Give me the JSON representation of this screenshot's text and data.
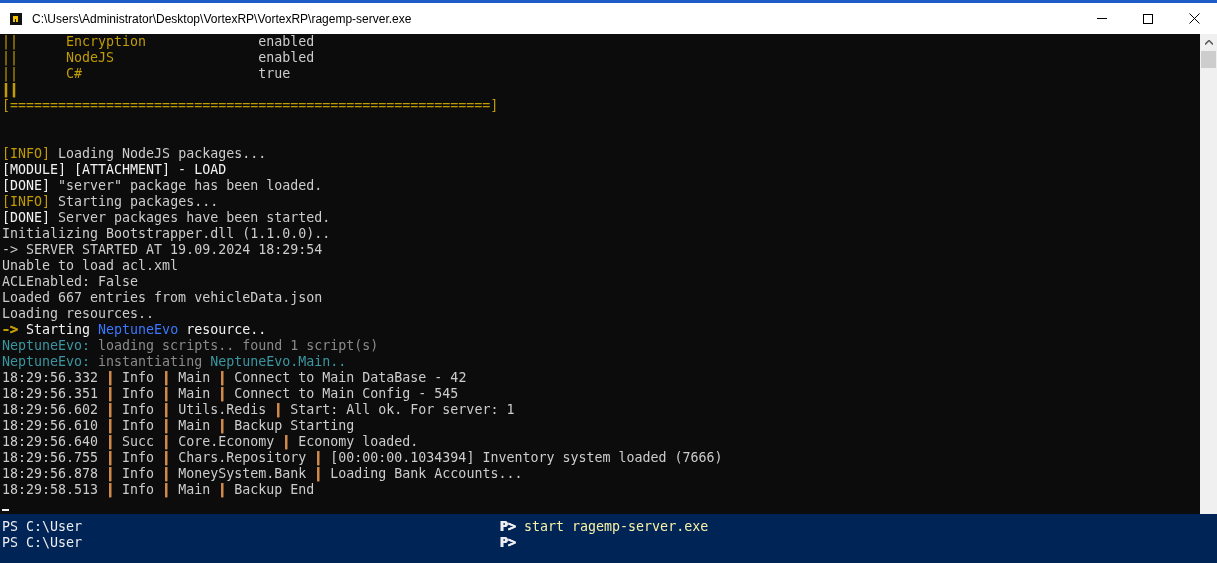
{
  "window": {
    "title": "C:\\Users\\Administrator\\Desktop\\VortexRP\\VortexRP\\ragemp-server.exe"
  },
  "console": {
    "lines": [
      {
        "kind": "text",
        "segments": [
          {
            "text": "||      Encryption              ",
            "color": "#c19c00"
          },
          {
            "text": "enabled",
            "color": "#cccccc"
          }
        ]
      },
      {
        "kind": "text",
        "segments": [
          {
            "text": "||      NodeJS                  ",
            "color": "#c19c00"
          },
          {
            "text": "enabled",
            "color": "#cccccc"
          }
        ]
      },
      {
        "kind": "text",
        "segments": [
          {
            "text": "||      C#                      ",
            "color": "#c19c00"
          },
          {
            "text": "true",
            "color": "#cccccc"
          }
        ]
      },
      {
        "kind": "text",
        "segments": [
          {
            "text": "||",
            "color": "#c19c00"
          }
        ]
      },
      {
        "kind": "text",
        "segments": [
          {
            "text": "[============================================================]",
            "color": "#c19c00"
          }
        ]
      },
      {
        "kind": "blank"
      },
      {
        "kind": "blank"
      },
      {
        "kind": "text",
        "segments": [
          {
            "text": "[INFO]",
            "color": "#c19c00"
          },
          {
            "text": " Loading NodeJS packages...",
            "color": "#cccccc"
          }
        ]
      },
      {
        "kind": "text",
        "segments": [
          {
            "text": "[MODULE] [ATTACHMENT] - LOAD",
            "color": "#f2f2f2"
          }
        ]
      },
      {
        "kind": "text",
        "segments": [
          {
            "text": "[DONE]",
            "color": "#f2f2f2"
          },
          {
            "text": " \"server\" package has been loaded.",
            "color": "#cccccc"
          }
        ]
      },
      {
        "kind": "text",
        "segments": [
          {
            "text": "[INFO]",
            "color": "#c19c00"
          },
          {
            "text": " Starting packages...",
            "color": "#cccccc"
          }
        ]
      },
      {
        "kind": "text",
        "segments": [
          {
            "text": "[DONE]",
            "color": "#f2f2f2"
          },
          {
            "text": " Server packages have been started.",
            "color": "#cccccc"
          }
        ]
      },
      {
        "kind": "text",
        "segments": [
          {
            "text": "Initializing Bootstrapper.dll (1.1.0.0)..",
            "color": "#cccccc"
          }
        ]
      },
      {
        "kind": "text",
        "segments": [
          {
            "text": "-> SERVER STARTED AT 19.09.2024 18:29:54",
            "color": "#cccccc"
          }
        ]
      },
      {
        "kind": "text",
        "segments": [
          {
            "text": "Unable to load acl.xml",
            "color": "#cccccc"
          }
        ]
      },
      {
        "kind": "text",
        "segments": [
          {
            "text": "ACLEnabled: False",
            "color": "#cccccc"
          }
        ]
      },
      {
        "kind": "text",
        "segments": [
          {
            "text": "Loaded 667 entries from vehicleData.json",
            "color": "#cccccc"
          }
        ]
      },
      {
        "kind": "text",
        "segments": [
          {
            "text": "Loading resources..",
            "color": "#cccccc"
          }
        ]
      },
      {
        "kind": "text",
        "segments": [
          {
            "text": "->",
            "color": "#c19c00"
          },
          {
            "text": " Starting ",
            "color": "#f2f2f2"
          },
          {
            "text": "NeptuneEvo",
            "color": "#3b78ff"
          },
          {
            "text": " resource..",
            "color": "#f2f2f2"
          }
        ]
      },
      {
        "kind": "text",
        "segments": [
          {
            "text": "NeptuneEvo:",
            "color": "#3a96a0"
          },
          {
            "text": " loading scripts.. found 1 script(s)",
            "color": "#8a8a8a"
          }
        ]
      },
      {
        "kind": "text",
        "segments": [
          {
            "text": "NeptuneEvo:",
            "color": "#3a96a0"
          },
          {
            "text": " instantiating ",
            "color": "#8a8a8a"
          },
          {
            "text": "NeptuneEvo.Main..",
            "color": "#3a96a0"
          }
        ]
      },
      {
        "kind": "text",
        "segments": [
          {
            "text": "18:29:56.332 ",
            "color": "#cccccc"
          },
          {
            "text": "|",
            "color": "#d08a4a"
          },
          {
            "text": " Info ",
            "color": "#cccccc"
          },
          {
            "text": "|",
            "color": "#d08a4a"
          },
          {
            "text": " Main ",
            "color": "#cccccc"
          },
          {
            "text": "|",
            "color": "#d08a4a"
          },
          {
            "text": " Connect to Main DataBase - 42",
            "color": "#cccccc"
          }
        ]
      },
      {
        "kind": "text",
        "segments": [
          {
            "text": "18:29:56.351 ",
            "color": "#cccccc"
          },
          {
            "text": "|",
            "color": "#d08a4a"
          },
          {
            "text": " Info ",
            "color": "#cccccc"
          },
          {
            "text": "|",
            "color": "#d08a4a"
          },
          {
            "text": " Main ",
            "color": "#cccccc"
          },
          {
            "text": "|",
            "color": "#d08a4a"
          },
          {
            "text": " Connect to Main Config - 545",
            "color": "#cccccc"
          }
        ]
      },
      {
        "kind": "text",
        "segments": [
          {
            "text": "18:29:56.602 ",
            "color": "#cccccc"
          },
          {
            "text": "|",
            "color": "#d08a4a"
          },
          {
            "text": " Info ",
            "color": "#cccccc"
          },
          {
            "text": "|",
            "color": "#d08a4a"
          },
          {
            "text": " Utils.Redis ",
            "color": "#cccccc"
          },
          {
            "text": "|",
            "color": "#d08a4a"
          },
          {
            "text": " Start: All ok. For server: 1",
            "color": "#cccccc"
          }
        ]
      },
      {
        "kind": "text",
        "segments": [
          {
            "text": "18:29:56.610 ",
            "color": "#cccccc"
          },
          {
            "text": "|",
            "color": "#d08a4a"
          },
          {
            "text": " Info ",
            "color": "#cccccc"
          },
          {
            "text": "|",
            "color": "#d08a4a"
          },
          {
            "text": " Main ",
            "color": "#cccccc"
          },
          {
            "text": "|",
            "color": "#d08a4a"
          },
          {
            "text": " Backup Starting",
            "color": "#cccccc"
          }
        ]
      },
      {
        "kind": "text",
        "segments": [
          {
            "text": "18:29:56.640 ",
            "color": "#cccccc"
          },
          {
            "text": "|",
            "color": "#d08a4a"
          },
          {
            "text": " Succ ",
            "color": "#cccccc"
          },
          {
            "text": "|",
            "color": "#d08a4a"
          },
          {
            "text": " Core.Economy ",
            "color": "#cccccc"
          },
          {
            "text": "|",
            "color": "#d08a4a"
          },
          {
            "text": " Economy loaded.",
            "color": "#cccccc"
          }
        ]
      },
      {
        "kind": "text",
        "segments": [
          {
            "text": "18:29:56.755 ",
            "color": "#cccccc"
          },
          {
            "text": "|",
            "color": "#d08a4a"
          },
          {
            "text": " Info ",
            "color": "#cccccc"
          },
          {
            "text": "|",
            "color": "#d08a4a"
          },
          {
            "text": " Chars.Repository ",
            "color": "#cccccc"
          },
          {
            "text": "|",
            "color": "#d08a4a"
          },
          {
            "text": " [00:00:00.1034394] Inventory system loaded (7666)",
            "color": "#cccccc"
          }
        ]
      },
      {
        "kind": "text",
        "segments": [
          {
            "text": "18:29:56.878 ",
            "color": "#cccccc"
          },
          {
            "text": "|",
            "color": "#d08a4a"
          },
          {
            "text": " Info ",
            "color": "#cccccc"
          },
          {
            "text": "|",
            "color": "#d08a4a"
          },
          {
            "text": " MoneySystem.Bank ",
            "color": "#cccccc"
          },
          {
            "text": "|",
            "color": "#d08a4a"
          },
          {
            "text": " Loading Bank Accounts...",
            "color": "#cccccc"
          }
        ]
      },
      {
        "kind": "text",
        "segments": [
          {
            "text": "18:29:58.513 ",
            "color": "#cccccc"
          },
          {
            "text": "|",
            "color": "#d08a4a"
          },
          {
            "text": " Info ",
            "color": "#cccccc"
          },
          {
            "text": "|",
            "color": "#d08a4a"
          },
          {
            "text": " Main ",
            "color": "#cccccc"
          },
          {
            "text": "|",
            "color": "#d08a4a"
          },
          {
            "text": " Backup End",
            "color": "#cccccc"
          }
        ]
      }
    ]
  },
  "powershell": {
    "lines": [
      {
        "prompt": "PS C:\\User",
        "segments": [
          {
            "text": "P> ",
            "color": "#eeedf0"
          },
          {
            "text": "start ragemp-server.exe",
            "color": "#f9f1a5"
          }
        ]
      },
      {
        "prompt": "PS C:\\User",
        "segments": [
          {
            "text": "P>",
            "color": "#eeedf0"
          }
        ]
      }
    ]
  }
}
